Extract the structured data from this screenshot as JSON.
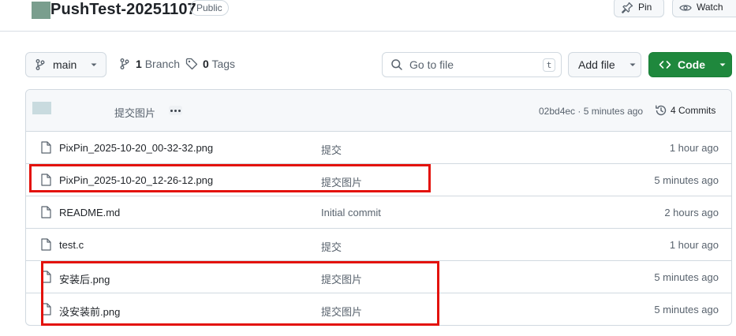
{
  "repo": {
    "title": "PushTest-20251107",
    "visibility": "Public",
    "pin_label": "Pin",
    "watch_label": "Watch"
  },
  "toolbar": {
    "branch_name": "main",
    "branch_count": "1",
    "branch_label": "Branch",
    "tag_count": "0",
    "tag_label": "Tags",
    "search_placeholder": "Go to file",
    "search_shortcut": "t",
    "add_file_label": "Add file",
    "code_label": "Code"
  },
  "latest_commit": {
    "message": "提交图片",
    "hash_and_time": "02bd4ec · 5 minutes ago",
    "commits_label": "4 Commits"
  },
  "files": [
    {
      "name": "PixPin_2025-10-20_00-32-32.png",
      "commit": "提交",
      "age": "1 hour ago"
    },
    {
      "name": "PixPin_2025-10-20_12-26-12.png",
      "commit": "提交图片",
      "age": "5 minutes ago"
    },
    {
      "name": "README.md",
      "commit": "Initial commit",
      "age": "2 hours ago"
    },
    {
      "name": "test.c",
      "commit": "提交",
      "age": "1 hour ago"
    },
    {
      "name": "安装后.png",
      "commit": "提交图片",
      "age": "5 minutes ago"
    },
    {
      "name": "没安装前.png",
      "commit": "提交图片",
      "age": "5 minutes ago"
    }
  ],
  "colors": {
    "accent_green": "#1f883d",
    "annotation_red": "#e3120b",
    "muted_text": "#59636e"
  }
}
